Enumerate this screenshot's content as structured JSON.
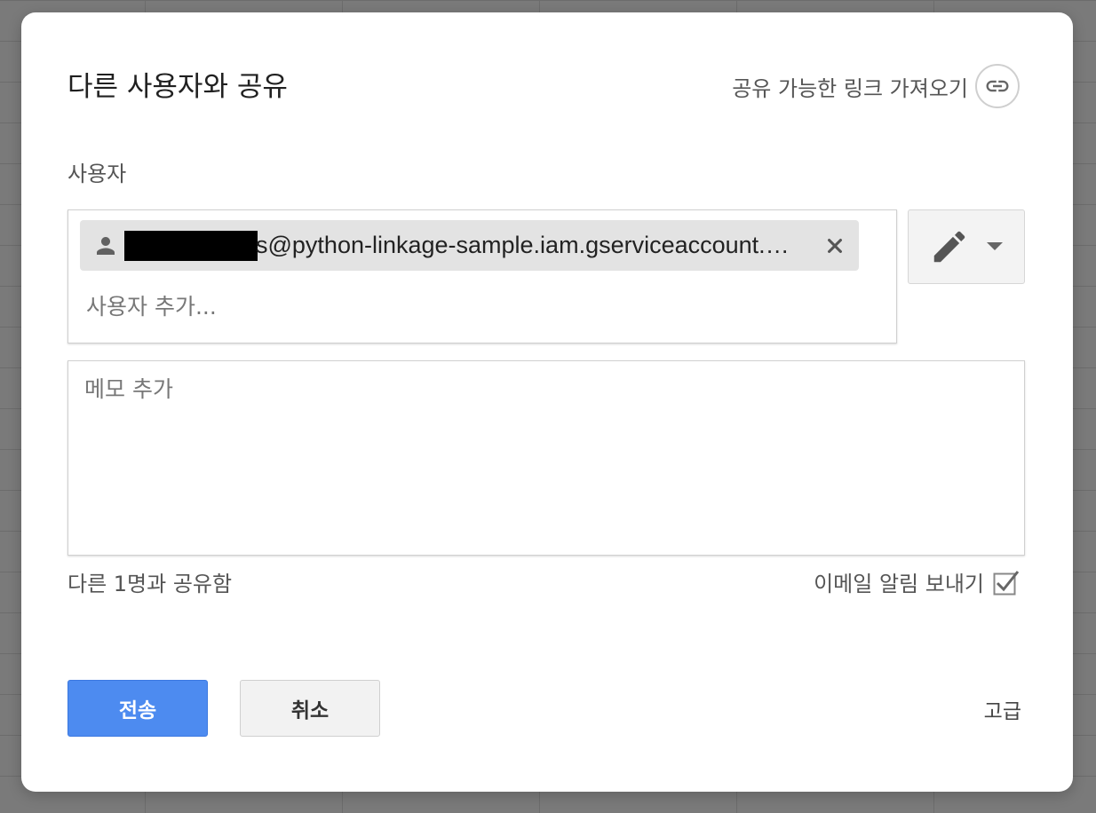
{
  "dialog": {
    "title": "다른 사용자와 공유",
    "get_link_label": "공유 가능한 링크 가져오기"
  },
  "people": {
    "label": "사용자",
    "chips": [
      {
        "email_visible": "s@python-linkage-sample.iam.gserviceaccount.…"
      }
    ],
    "add_placeholder": "사용자 추가..."
  },
  "permission": {
    "icon": "pencil-icon",
    "dropdown_icon": "caret-down-icon"
  },
  "memo": {
    "placeholder": "메모 추가"
  },
  "footer_info": {
    "shared_count": "다른 1명과 공유함",
    "notify_label": "이메일 알림 보내기",
    "notify_checked": true
  },
  "actions": {
    "send_label": "전송",
    "cancel_label": "취소",
    "advanced_label": "고급"
  },
  "colors": {
    "primary": "#4d8bf0",
    "chip_bg": "#e3e3e3",
    "backdrop": "#7a7a7a"
  }
}
